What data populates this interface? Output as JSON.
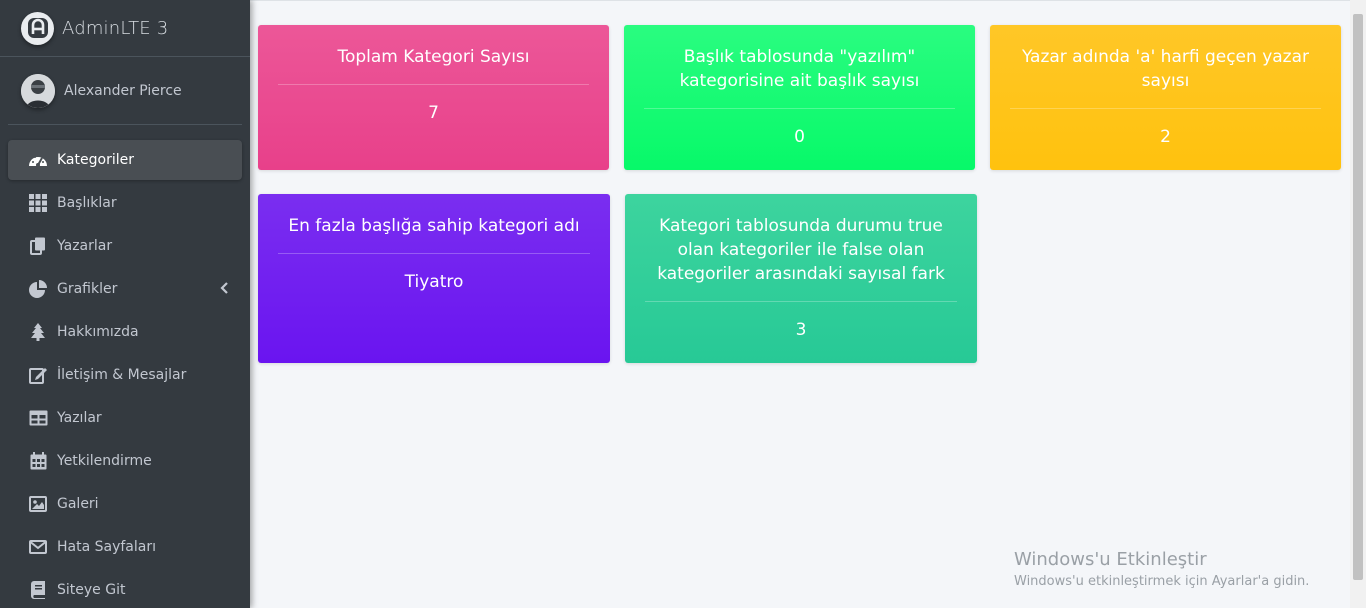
{
  "brand": {
    "name": "AdminLTE 3"
  },
  "user": {
    "name": "Alexander Pierce"
  },
  "nav": [
    {
      "label": "Kategoriler",
      "icon": "dashboard-icon",
      "active": true
    },
    {
      "label": "Başlıklar",
      "icon": "grid-icon"
    },
    {
      "label": "Yazarlar",
      "icon": "copy-icon"
    },
    {
      "label": "Grafikler",
      "icon": "pie-chart-icon",
      "has_caret": true
    },
    {
      "label": "Hakkımızda",
      "icon": "tree-icon"
    },
    {
      "label": "İletişim & Mesajlar",
      "icon": "edit-icon"
    },
    {
      "label": "Yazılar",
      "icon": "table-icon"
    },
    {
      "label": "Yetkilendirme",
      "icon": "calendar-icon"
    },
    {
      "label": "Galeri",
      "icon": "image-icon"
    },
    {
      "label": "Hata Sayfaları",
      "icon": "envelope-icon"
    },
    {
      "label": "Siteye Git",
      "icon": "book-icon"
    }
  ],
  "cards": [
    {
      "title": "Toplam Kategori Sayısı",
      "value": "7",
      "color": "#e8408a"
    },
    {
      "title": "Başlık tablosunda \"yazılım\" kategorisine ait başlık sayısı",
      "value": "0",
      "color": "#07f969"
    },
    {
      "title": "Yazar adında 'a' harfi geçen yazar sayısı",
      "value": "2",
      "color": "#ffc20e"
    },
    {
      "title": "En fazla başlığa sahip kategori adı",
      "value": "Tiyatro",
      "color": "#6a14f0"
    },
    {
      "title": "Kategori tablosunda durumu true olan kategoriler ile false olan kategoriler arasındaki sayısal fark",
      "value": "3",
      "color": "#27c996"
    }
  ],
  "activation": {
    "title": "Windows'u Etkinleştir",
    "subtitle": "Windows'u etkinleştirmek için Ayarlar'a gidin."
  }
}
